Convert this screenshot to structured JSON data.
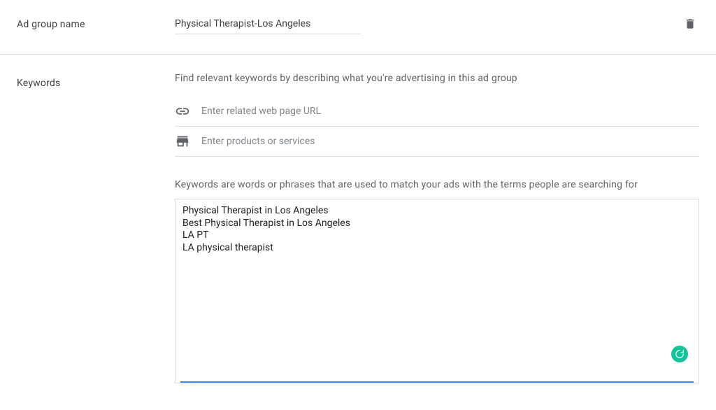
{
  "labels": {
    "adGroupName": "Ad group name",
    "keywords": "Keywords"
  },
  "adGroup": {
    "nameValue": "Physical Therapist-Los Angeles"
  },
  "keywordsSection": {
    "findHelper": "Find relevant keywords by describing what you're advertising in this ad group",
    "urlPlaceholder": "Enter related web page URL",
    "productsPlaceholder": "Enter products or services",
    "description": "Keywords are words or phrases that are used to match your ads with the terms people are searching for",
    "textareaValue": "Physical Therapist in Los Angeles\nBest Physical Therapist in Los Angeles\nLA PT\nLA physical therapist\n"
  }
}
